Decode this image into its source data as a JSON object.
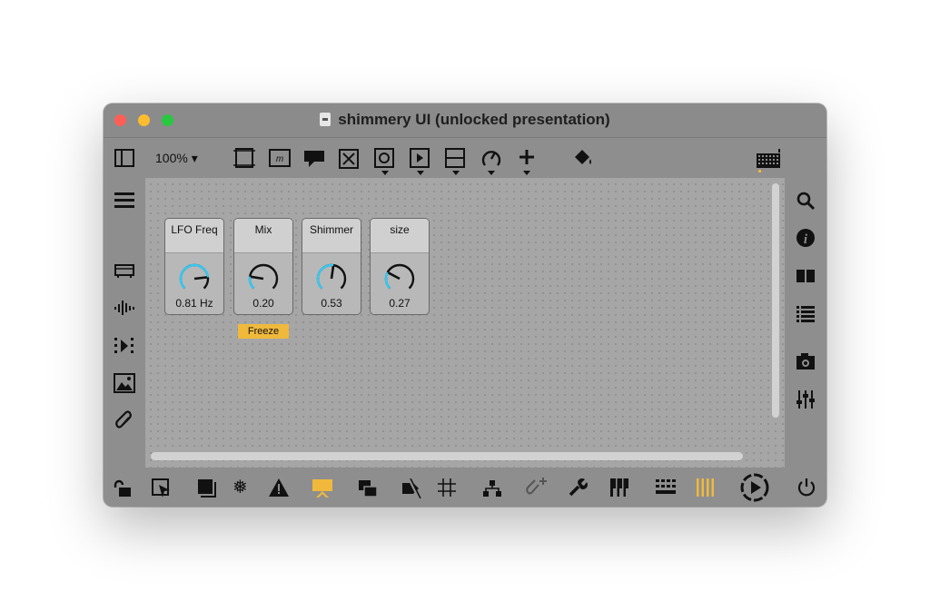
{
  "window": {
    "title": "shimmery UI (unlocked presentation)"
  },
  "toolbar": {
    "zoom": "100% ▾"
  },
  "dials": [
    {
      "label": "LFO Freq",
      "value": "0.81 Hz",
      "fraction": 0.81
    },
    {
      "label": "Mix",
      "value": "0.20",
      "fraction": 0.2
    },
    {
      "label": "Shimmer",
      "value": "0.53",
      "fraction": 0.53
    },
    {
      "label": "size",
      "value": "0.27",
      "fraction": 0.27
    }
  ],
  "freeze_button": {
    "label": "Freeze"
  },
  "left_sidebar": {
    "icons": [
      "menu-icon",
      "presentation-icon",
      "audio-icon",
      "sequence-icon",
      "image-icon",
      "paperclip-icon"
    ]
  },
  "right_sidebar": {
    "icons": [
      "search-icon",
      "info-icon",
      "book-icon",
      "list-icon",
      "camera-icon",
      "mixer-icon"
    ]
  },
  "bottom_bar": {
    "icons": [
      "lock-icon",
      "select-icon",
      "frame-icon",
      "snowflake-icon",
      "warning-icon",
      "presentation-toggle-icon",
      "layers-icon",
      "mute-icon",
      "grid-icon",
      "hierarchy-icon",
      "add-dependency-icon",
      "wrench-icon",
      "piano-icon",
      "keyboard-icon",
      "columns-icon",
      "play-icon",
      "power-icon"
    ]
  },
  "colors": {
    "accent": "#f0b93c",
    "dial_arc": "#39c6ee",
    "window_bg": "#8e8e8e",
    "canvas_bg": "#a6a6a6"
  }
}
